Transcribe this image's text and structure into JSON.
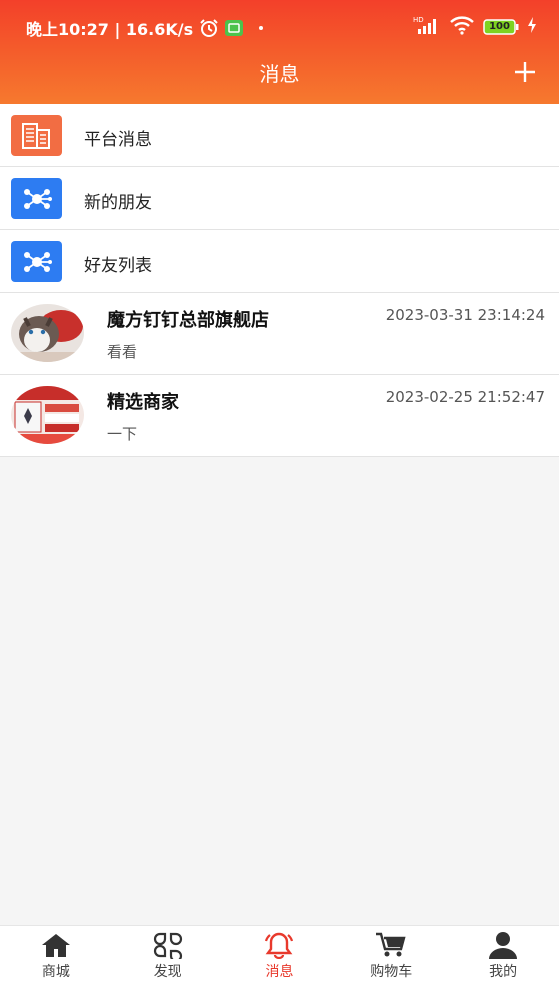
{
  "status_bar": {
    "time_text": "晚上10:27 | 16.6K/s",
    "network_label": "HD",
    "battery": "100"
  },
  "header": {
    "title": "消息"
  },
  "entries": [
    {
      "label": "平台消息",
      "icon": "document-icon",
      "color": "#f26d43"
    },
    {
      "label": "新的朋友",
      "icon": "network-icon",
      "color": "#2d7cf2"
    },
    {
      "label": "好友列表",
      "icon": "network-icon",
      "color": "#2d7cf2"
    }
  ],
  "conversations": [
    {
      "name": "魔方钉钉总部旗舰店",
      "time": "2023-03-31 23:14:24",
      "message": "看看"
    },
    {
      "name": "精选商家",
      "time": "2023-02-25 21:52:47",
      "message": "一下"
    }
  ],
  "tabs": [
    {
      "label": "商城",
      "icon": "home-icon"
    },
    {
      "label": "发现",
      "icon": "discover-icon"
    },
    {
      "label": "消息",
      "icon": "bell-icon",
      "active": true
    },
    {
      "label": "购物车",
      "icon": "cart-icon"
    },
    {
      "label": "我的",
      "icon": "user-icon"
    }
  ],
  "colors": {
    "header_start": "#f3402a",
    "header_end": "#f6792e",
    "active_tab": "#e8392c",
    "blue_icon": "#2d7cf2",
    "orange_icon": "#f26d43"
  }
}
